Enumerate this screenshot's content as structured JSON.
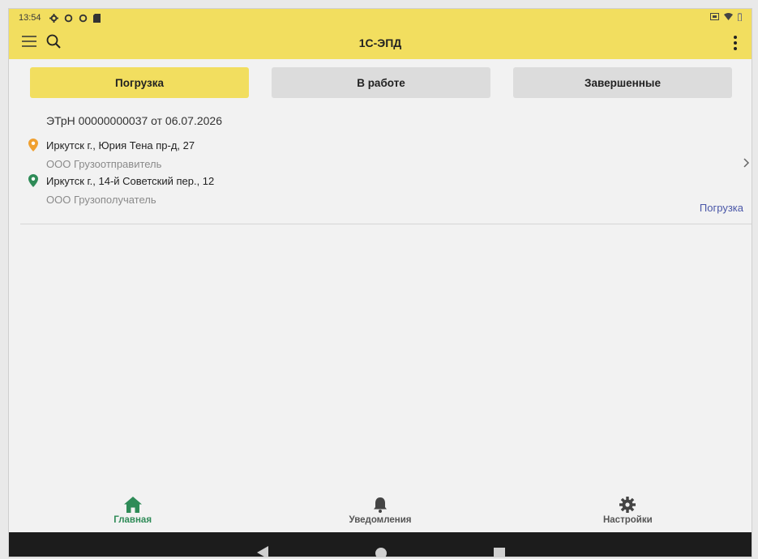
{
  "status_bar": {
    "time": "13:54"
  },
  "app_bar": {
    "title": "1С-ЭПД"
  },
  "tabs": [
    {
      "label": "Погрузка",
      "active": true
    },
    {
      "label": "В работе",
      "active": false
    },
    {
      "label": "Завершенные",
      "active": false
    }
  ],
  "shipments": [
    {
      "doc_title": "ЭТрН 00000000037 от 06.07.2026",
      "from_address": "Иркутск г., Юрия Тена пр-д, 27",
      "from_company": "ООО Грузоотправитель",
      "to_address": "Иркутск г., 14-й Советский пер., 12",
      "to_company": "ООО Грузополучатель",
      "status": "Погрузка"
    }
  ],
  "bottom_nav": [
    {
      "label": "Главная",
      "icon": "home-icon",
      "active": true
    },
    {
      "label": "Уведомления",
      "icon": "bell-icon",
      "active": false
    },
    {
      "label": "Настройки",
      "icon": "gear-icon",
      "active": false
    }
  ],
  "colors": {
    "header": "#f2de5f",
    "active_tab": "#f2de5f",
    "inactive_tab": "#dcdcdc",
    "origin_pin": "#f0a030",
    "destination_pin": "#2e8b57",
    "status_link": "#4a57a8",
    "active_nav": "#2e8b57"
  }
}
